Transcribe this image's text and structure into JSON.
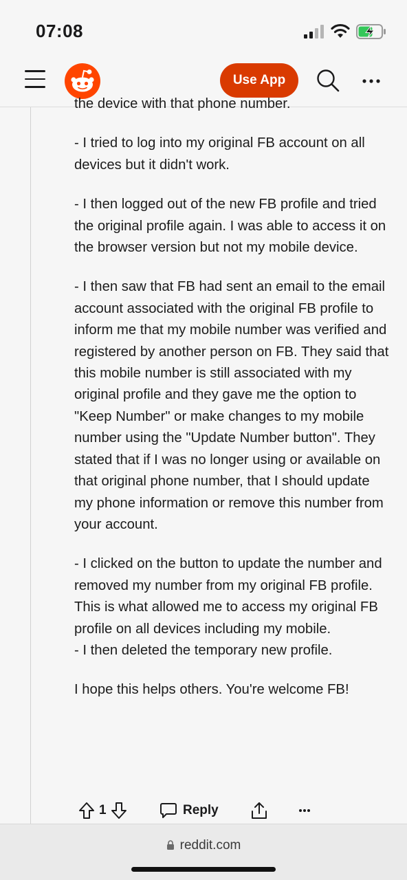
{
  "status_bar": {
    "time": "07:08"
  },
  "header": {
    "use_app_label": "Use App"
  },
  "comment": {
    "cutoff_line": "the device with that phone number.",
    "paragraphs": [
      "- I tried to log into my original FB account on all devices but it didn't work.",
      "- I then logged out of the new FB profile and tried the original profile again. I was able to access it on the browser version but not my mobile device.",
      "- I then saw that FB had sent an email to the email account associated with the original FB profile to inform me that my mobile number was verified and registered by another person on FB. They said that this mobile number is still associated with my original profile and they gave me the option to \"Keep Number\" or make changes to my mobile number using the \"Update Number button\". They stated that if I was no longer using or available on that original phone number, that I should update my phone information or remove this number from your account.",
      "- I clicked on the button to update the number and removed my number from my original FB profile. This is what allowed me to access my original FB profile on all devices including my mobile.",
      "- I then deleted the temporary new profile.",
      "I hope this helps others. You're welcome FB!"
    ],
    "vote_count": "1",
    "reply_label": "Reply"
  },
  "browser": {
    "url": "reddit.com"
  },
  "colors": {
    "accent": "#d93a00",
    "background": "#f6f6f6"
  }
}
